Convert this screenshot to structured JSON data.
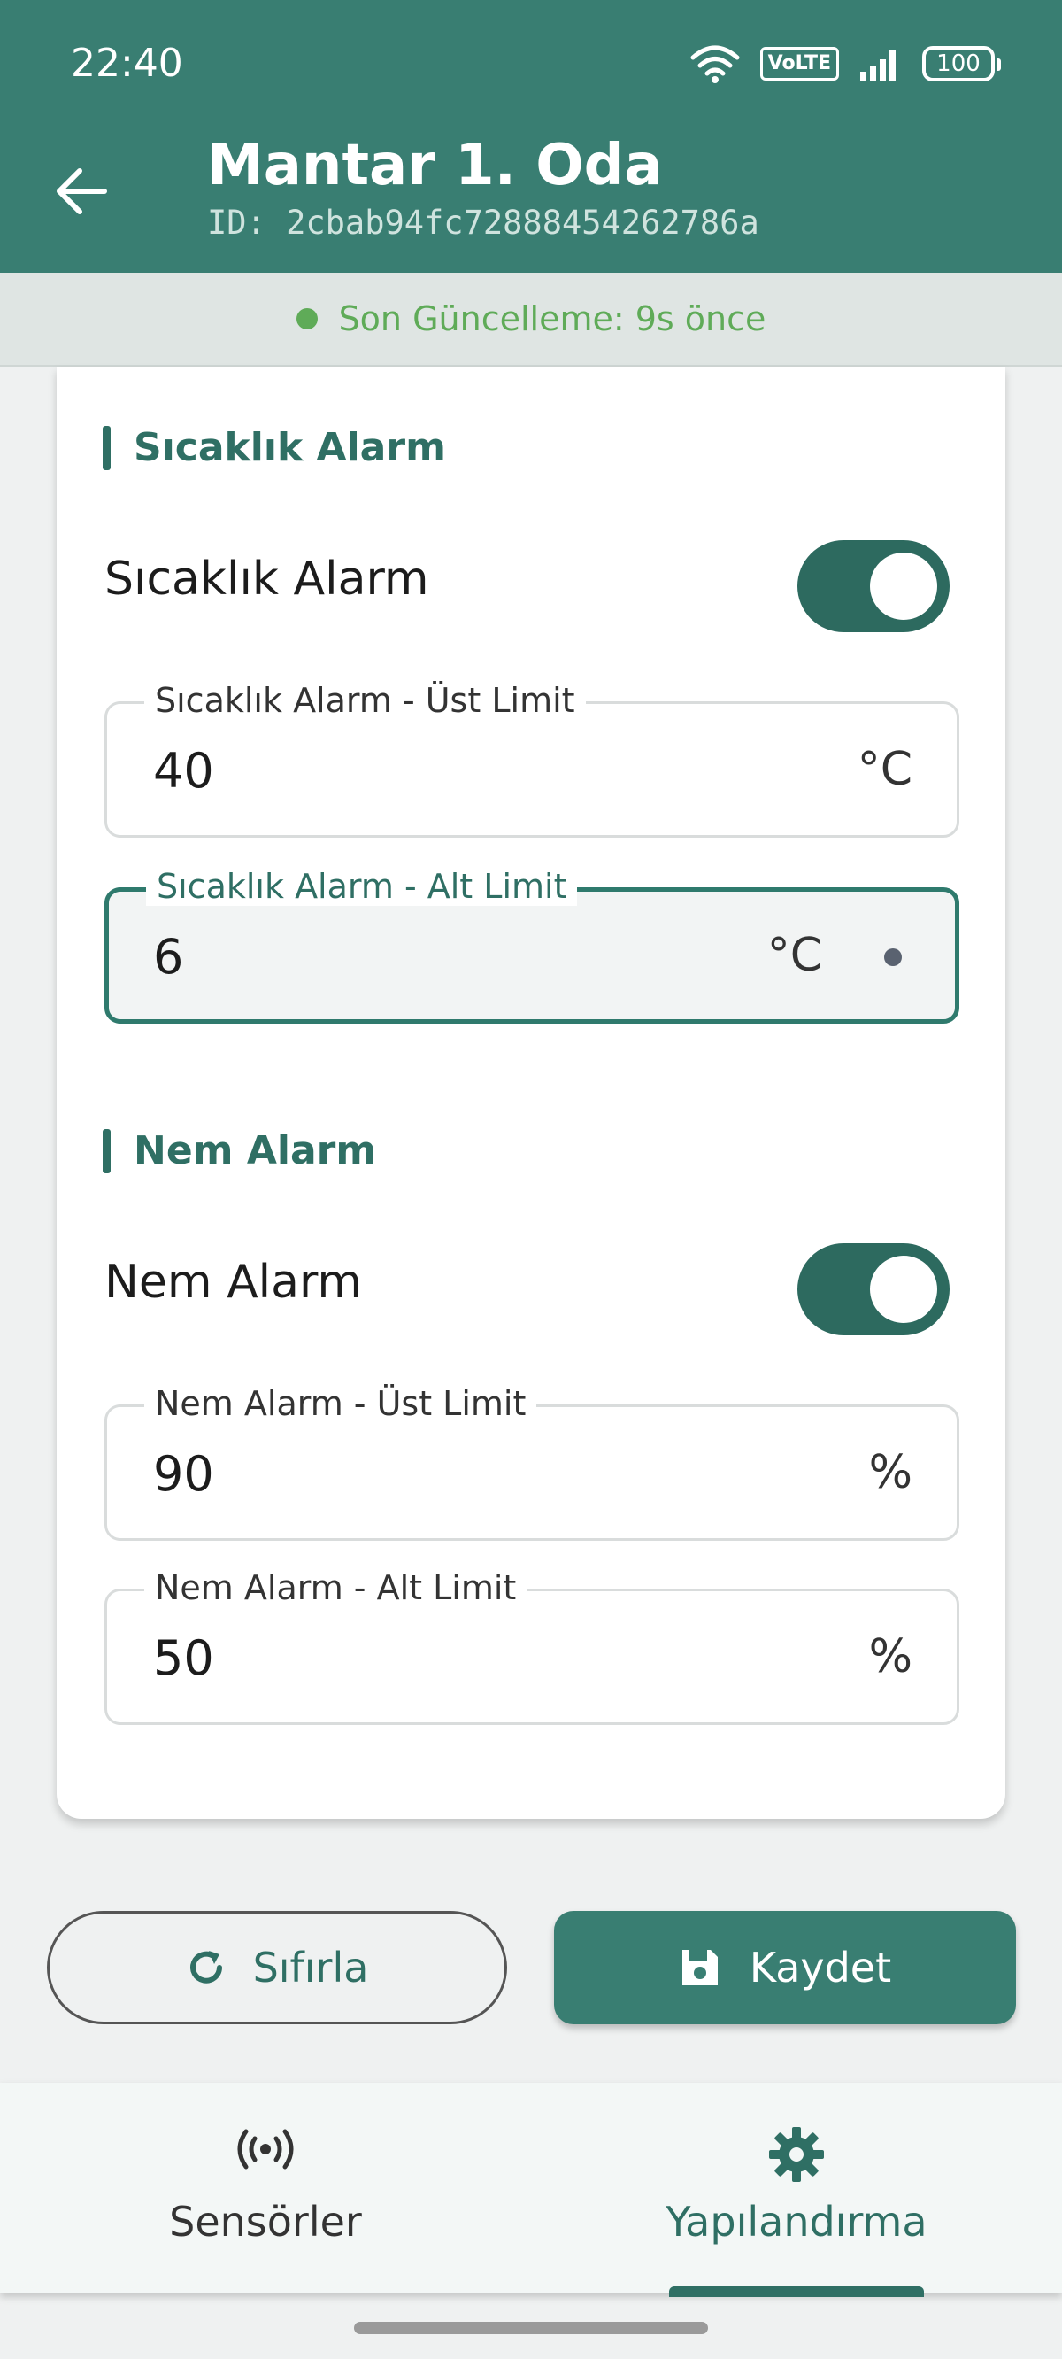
{
  "status_bar": {
    "time": "22:40",
    "network_label": "VoLTE",
    "battery": "100",
    "icons": [
      "wifi-icon",
      "volte-icon",
      "signal-icon",
      "battery-icon"
    ]
  },
  "header": {
    "title": "Mantar 1. Oda",
    "subtitle": "ID: 2cbab94fc72888454262786a",
    "back_icon": "arrow-left-icon"
  },
  "update": {
    "text": "Son Güncelleme: 9s önce",
    "status_color": "#5fab58"
  },
  "temperature": {
    "section_title": "Sıcaklık Alarm",
    "toggle_label": "Sıcaklık Alarm",
    "toggle_on": true,
    "upper": {
      "label": "Sıcaklık Alarm - Üst Limit",
      "value": "40",
      "unit": "°C"
    },
    "lower": {
      "label": "Sıcaklık Alarm - Alt Limit",
      "value": "6",
      "unit": "°C"
    }
  },
  "humidity": {
    "section_title": "Nem Alarm",
    "toggle_label": "Nem Alarm",
    "toggle_on": true,
    "upper": {
      "label": "Nem Alarm - Üst Limit",
      "value": "90",
      "unit": "%"
    },
    "lower": {
      "label": "Nem Alarm - Alt Limit",
      "value": "50",
      "unit": "%"
    }
  },
  "actions": {
    "reset_label": "Sıfırla",
    "reset_icon": "refresh-icon",
    "save_label": "Kaydet",
    "save_icon": "save-icon"
  },
  "bottom_nav": {
    "items": [
      {
        "label": "Sensörler",
        "icon": "sensor-icon",
        "active": false
      },
      {
        "label": "Yapılandırma",
        "icon": "gear-icon",
        "active": true
      }
    ]
  },
  "colors": {
    "primary": "#397e72",
    "primary_dark": "#2f6f64",
    "background": "#eff1f1"
  }
}
